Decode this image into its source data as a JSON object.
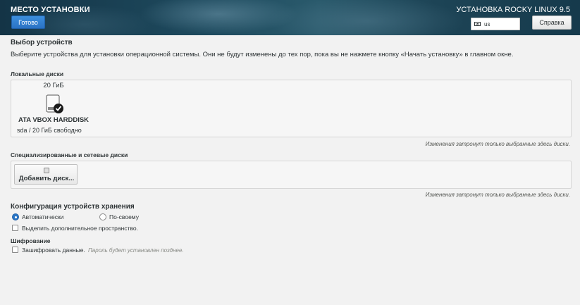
{
  "header": {
    "title": "МЕСТО УСТАНОВКИ",
    "product": "УСТАНОВКА ROCKY LINUX 9.5",
    "done_label": "Готово",
    "help_label": "Справка",
    "keyboard_layout": "us"
  },
  "device_selection": {
    "title": "Выбор устройств",
    "description": "Выберите устройства для установки операционной системы. Они не будут изменены до тех пор, пока вы не нажмете кнопку «Начать установку» в главном окне."
  },
  "local_disks": {
    "title": "Локальные диски",
    "disks": [
      {
        "size": "20 ГиБ",
        "name": "ATA VBOX HARDDISK",
        "info": "sda  /  20 ГиБ свободно",
        "selected": true
      }
    ],
    "note": "Изменения затронут только выбранные здесь диски."
  },
  "special_disks": {
    "title": "Специализированные и сетевые диски",
    "add_label": "Добавить диск...",
    "note": "Изменения затронут только выбранные здесь диски."
  },
  "storage_config": {
    "title": "Конфигурация устройств хранения",
    "option_auto": "Автоматически",
    "option_custom": "По-своему",
    "selected": "auto",
    "extra_space_label": "Выделить дополнительное пространство."
  },
  "encryption": {
    "title": "Шифрование",
    "encrypt_label": "Зашифровать данные.",
    "encrypt_hint": "Пароль будет установлен позднее."
  },
  "colors": {
    "accent": "#2a76c6",
    "header_bg": "#1e4a5e"
  }
}
